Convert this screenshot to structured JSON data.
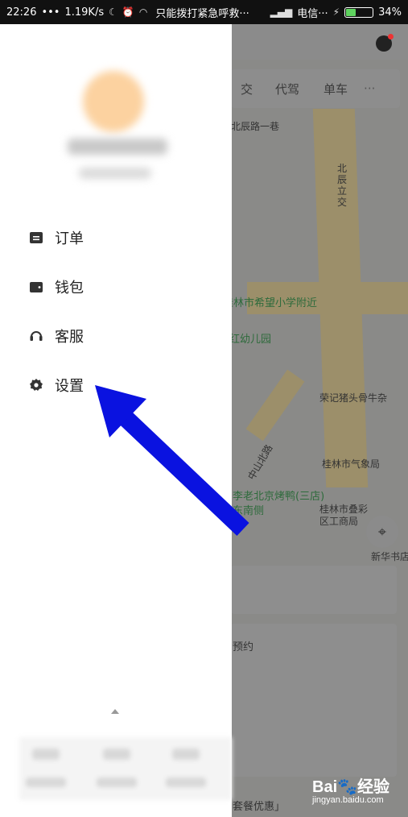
{
  "status_bar": {
    "time": "22:26",
    "dots": "•••",
    "speed": "1.19K/s",
    "notice": "只能拨打紧急呼救···",
    "carrier": "电信···",
    "battery": "34%",
    "battery_level": 0.34
  },
  "drawer": {
    "menu": [
      {
        "label": "订单",
        "icon": "order-icon"
      },
      {
        "label": "钱包",
        "icon": "wallet-icon"
      },
      {
        "label": "客服",
        "icon": "headset-icon"
      },
      {
        "label": "设置",
        "icon": "gear-icon"
      }
    ]
  },
  "map": {
    "modes": [
      "交",
      "代驾",
      "单车"
    ],
    "more": "···",
    "labels": {
      "road1": "北辰路一巷",
      "road2": "北辰立交",
      "poi1": "桂林市希望小学附近",
      "poi2": "红幼儿园",
      "poi3": "荣记猪头骨牛杂",
      "road3": "中山北路",
      "poi4": "桂林市气象局",
      "poi5": "李老北京烤鸭(三店)东南侧",
      "poi6": "桂林市叠彩区工商局",
      "poi7": "新华书店",
      "card2_text": "预约",
      "footer_text": "套餐优惠」"
    }
  },
  "watermark": {
    "brand": "Bai",
    "brand2": "经验",
    "url": "jingyan.baidu.com"
  },
  "colors": {
    "arrow": "#0a12e0",
    "drawer_bg": "#ffffff",
    "icon": "#333333"
  }
}
